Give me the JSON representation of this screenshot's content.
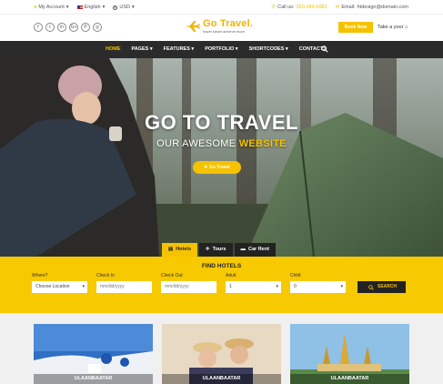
{
  "topbar": {
    "account": "My Account",
    "language": "English",
    "currency": "USD",
    "call_label": "Call us:",
    "phone": "320-049-6982",
    "email_label": "Email:",
    "email": "htdesign@domain.com"
  },
  "header": {
    "socials": [
      "f",
      "t",
      "in",
      "G+",
      "P",
      "◎"
    ],
    "logo_name": "Go Travel.",
    "logo_tag": "travel smart achieve more",
    "book_now": "Book Now",
    "take_tour": "Take a your"
  },
  "nav": {
    "items": [
      "HOME",
      "PAGES",
      "FEATURES",
      "PORTFOLIO",
      "SHORTCODES",
      "CONTACTS"
    ]
  },
  "hero": {
    "title": "GO TO TRAVEL",
    "subtitle_plain": "OUR AWESOME ",
    "subtitle_highlight": "WEBSITE",
    "button": "Go Travel"
  },
  "tabs": [
    {
      "label": "Hotels",
      "active": true
    },
    {
      "label": "Tours",
      "active": false
    },
    {
      "label": "Car Rent",
      "active": false
    }
  ],
  "find": {
    "title": "FIND HOTELS",
    "where_label": "Where?",
    "where_value": "Choose Location",
    "checkin_label": "Check In",
    "checkin_placeholder": "mm/dd/yyyy",
    "checkout_label": "Check Out",
    "checkout_placeholder": "mm/dd/yyyy",
    "adult_label": "Adult",
    "adult_value": "1",
    "child_label": "Child",
    "child_value": "0",
    "search": "SEARCH"
  },
  "cards": [
    "ULAANBAATAR",
    "ULAANBAATAR",
    "ULAANBAATAR"
  ],
  "colors": {
    "accent": "#f5c200",
    "dark": "#2b2b2b"
  }
}
